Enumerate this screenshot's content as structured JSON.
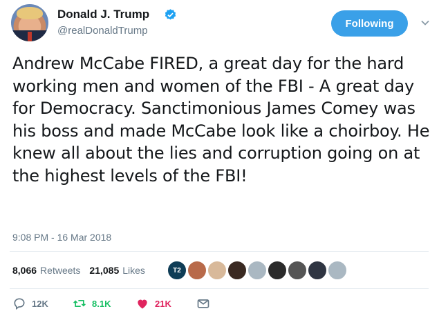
{
  "author": {
    "name": "Donald J. Trump",
    "handle": "@realDonaldTrump",
    "verified_icon": "verified-badge-icon"
  },
  "follow_button": {
    "label": "Following"
  },
  "tweet": {
    "text": "Andrew McCabe FIRED, a great day for the hard working men and women of the FBI - A great day for Democracy. Sanctimonious James Comey was his boss and made McCabe look like a choirboy. He knew all about the lies and corruption going on at the highest levels of the FBI!",
    "timestamp": "9:08 PM - 16 Mar 2018"
  },
  "stats": {
    "retweets_count": "8,066",
    "retweets_label": "Retweets",
    "likes_count": "21,085",
    "likes_label": "Likes"
  },
  "likers": [
    {
      "color": "#0f3d56",
      "label": "T2"
    },
    {
      "color": "#b86a4a"
    },
    {
      "color": "#d8b99a"
    },
    {
      "color": "#3a2a22"
    },
    {
      "color": "#aab8c2"
    },
    {
      "color": "#2b2b2b"
    },
    {
      "color": "#555555"
    },
    {
      "color": "#2f3542"
    },
    {
      "color": "#aab8c2"
    }
  ],
  "actions": {
    "reply_count": "12K",
    "retweet_count": "8.1K",
    "like_count": "21K"
  },
  "colors": {
    "accent": "#3aa0e8",
    "retweet": "#17bf63",
    "like": "#e0245e",
    "muted": "#657786"
  }
}
